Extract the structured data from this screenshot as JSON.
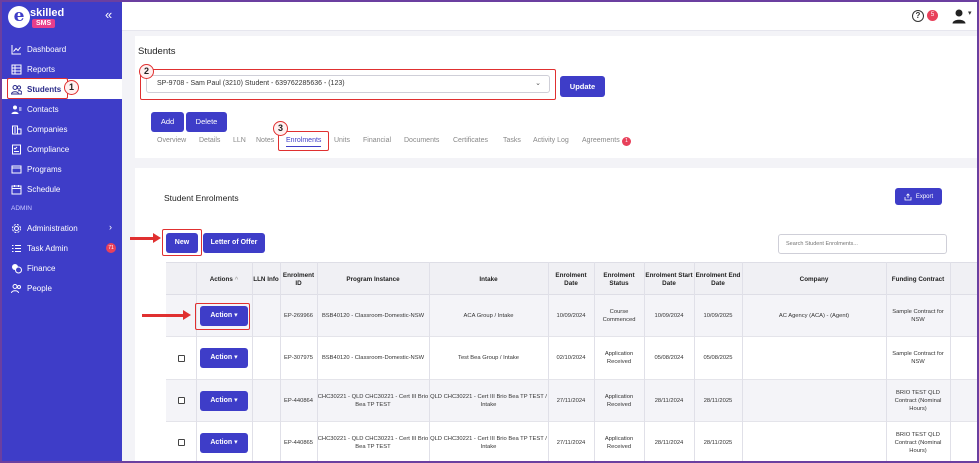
{
  "logo": {
    "letter": "e",
    "skilled": "skilled",
    "sms": "SMS"
  },
  "sidebar": {
    "collapse_glyph": "«",
    "items": [
      {
        "label": "Dashboard",
        "icon": "chart-line-icon"
      },
      {
        "label": "Reports",
        "icon": "table-icon"
      },
      {
        "label": "Students",
        "icon": "users-icon",
        "active": true
      },
      {
        "label": "Contacts",
        "icon": "contacts-icon"
      },
      {
        "label": "Companies",
        "icon": "building-icon"
      },
      {
        "label": "Compliance",
        "icon": "checklist-icon"
      },
      {
        "label": "Programs",
        "icon": "programs-icon"
      },
      {
        "label": "Schedule",
        "icon": "calendar-icon"
      }
    ],
    "section_admin": "ADMIN",
    "admin_items": [
      {
        "label": "Administration",
        "icon": "gear-icon"
      },
      {
        "label": "Task Admin",
        "icon": "list-icon",
        "badge": "71"
      },
      {
        "label": "Finance",
        "icon": "coins-icon"
      },
      {
        "label": "People",
        "icon": "people-icon"
      }
    ]
  },
  "topbar": {
    "help": "?",
    "notifications": "5",
    "user_caret": "▾"
  },
  "header": {
    "title": "Students",
    "student_select": "SP-9708 - Sam Paul (3210) Student - 639762285636 - (123)",
    "update_label": "Update",
    "add_label": "Add",
    "delete_label": "Delete",
    "tabs": [
      "Overview",
      "Details",
      "LLN",
      "Notes",
      "Enrolments",
      "Units",
      "Financial",
      "Documents",
      "Certificates",
      "Tasks",
      "Activity Log",
      "Agreements"
    ],
    "agreements_badge": "1"
  },
  "markers": {
    "m1": "1",
    "m2": "2",
    "m3": "3"
  },
  "enrolments": {
    "title": "Student Enrolments",
    "export_label": "Export",
    "new_label": "New",
    "offer_label": "Letter of Offer",
    "search_placeholder": "Search Student Enrolments...",
    "columns": [
      "Actions",
      "LLN Info",
      "Enrolment ID",
      "Program Instance",
      "Intake",
      "Enrolment Date",
      "Enrolment Status",
      "Enrolment Start Date",
      "Enrolment End Date",
      "Company",
      "Funding Contract"
    ],
    "action_label": "Action",
    "rows": [
      {
        "id": "EP-269966",
        "program": "BSB40120 - Classroom-Domestic-NSW",
        "intake": "ACA Group / Intake",
        "date": "10/09/2024",
        "status": "Course Commenced",
        "start": "10/09/2024",
        "end": "10/09/2025",
        "company": "AC Agency (ACA) - (Agent)",
        "funding": "Sample Contract for NSW"
      },
      {
        "id": "EP-307975",
        "program": "BSB40120 - Classroom-Domestic-NSW",
        "intake": "Test Bea Group / Intake",
        "date": "02/10/2024",
        "status": "Application Received",
        "start": "05/08/2024",
        "end": "05/08/2025",
        "company": "",
        "funding": "Sample Contract for NSW"
      },
      {
        "id": "EP-440864",
        "program": "CHC30221 - QLD CHC30221 - Cert III Brio Bea TP TEST",
        "intake": "QLD CHC30221 - Cert III Brio Bea TP TEST / Intake",
        "date": "27/11/2024",
        "status": "Application Received",
        "start": "28/11/2024",
        "end": "28/11/2025",
        "company": "",
        "funding": "BRIO TEST QLD Contract (Nominal Hours)"
      },
      {
        "id": "EP-440865",
        "program": "CHC30221 - QLD CHC30221 - Cert III Brio Bea TP TEST",
        "intake": "QLD CHC30221 - Cert III Brio Bea TP TEST / Intake",
        "date": "27/11/2024",
        "status": "Application Received",
        "start": "28/11/2024",
        "end": "28/11/2025",
        "company": "",
        "funding": "BRIO TEST QLD Contract (Nominal Hours)"
      }
    ]
  },
  "colors": {
    "primary": "#3e3dc8",
    "highlight": "#e03030",
    "badge": "#e8405a"
  }
}
